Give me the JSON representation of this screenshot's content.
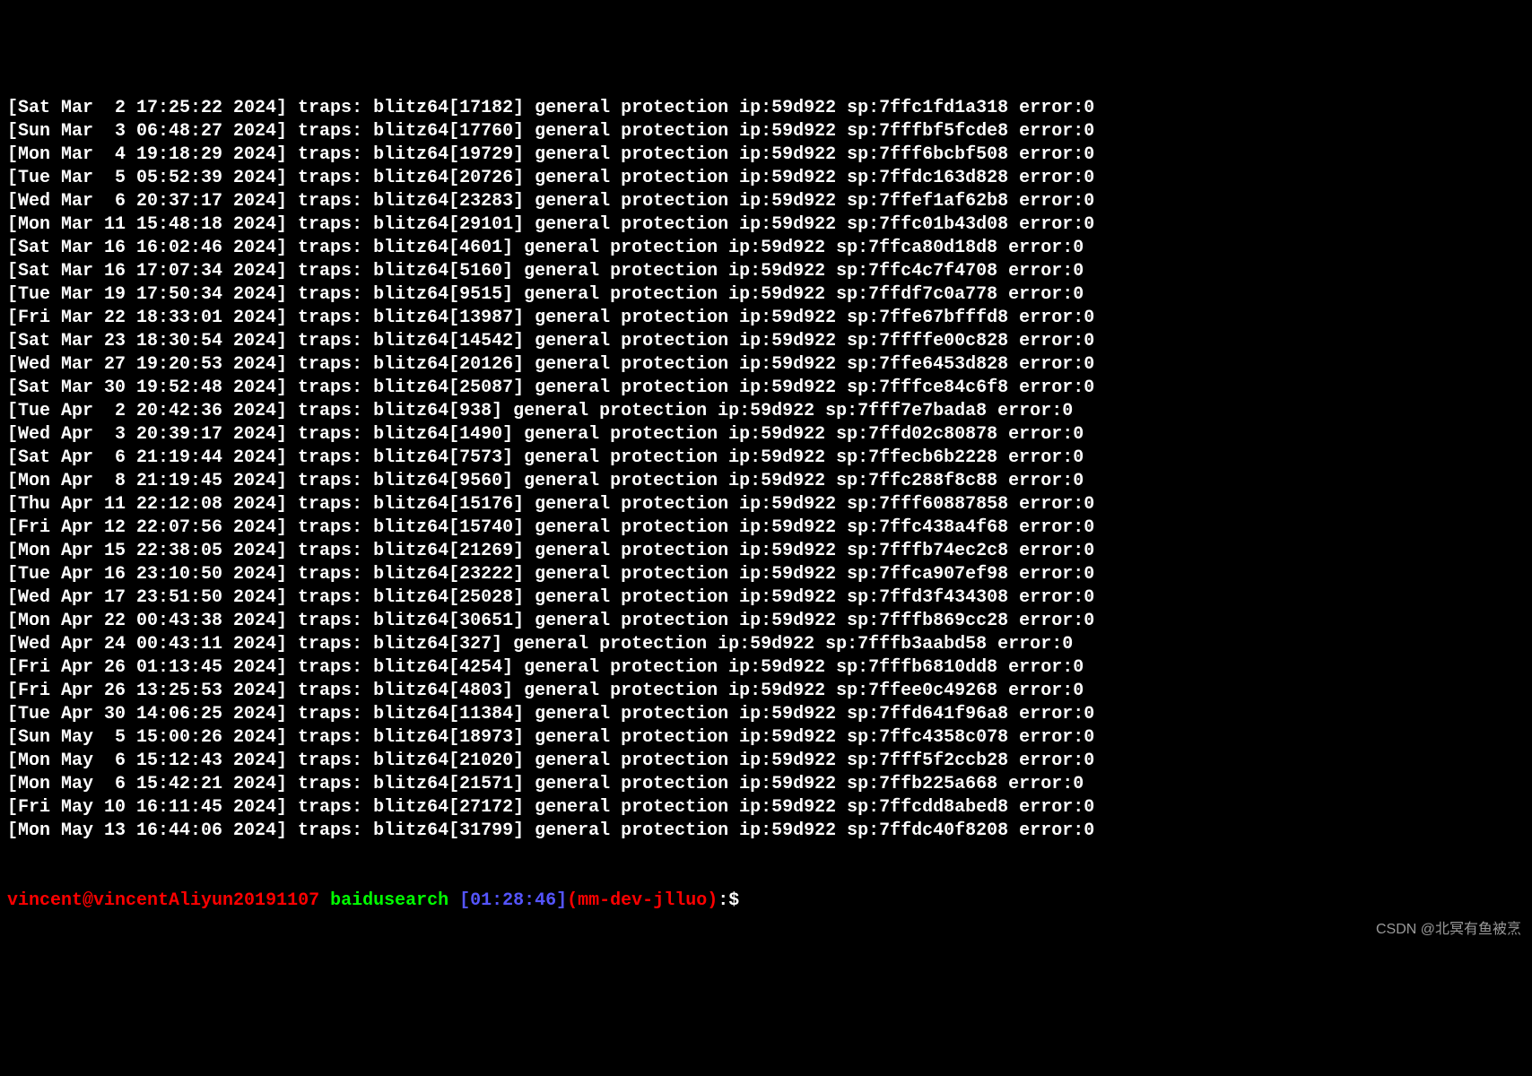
{
  "logs": [
    "[Sat Mar  2 17:25:22 2024] traps: blitz64[17182] general protection ip:59d922 sp:7ffc1fd1a318 error:0",
    "[Sun Mar  3 06:48:27 2024] traps: blitz64[17760] general protection ip:59d922 sp:7fffbf5fcde8 error:0",
    "[Mon Mar  4 19:18:29 2024] traps: blitz64[19729] general protection ip:59d922 sp:7fff6bcbf508 error:0",
    "[Tue Mar  5 05:52:39 2024] traps: blitz64[20726] general protection ip:59d922 sp:7ffdc163d828 error:0",
    "[Wed Mar  6 20:37:17 2024] traps: blitz64[23283] general protection ip:59d922 sp:7ffef1af62b8 error:0",
    "[Mon Mar 11 15:48:18 2024] traps: blitz64[29101] general protection ip:59d922 sp:7ffc01b43d08 error:0",
    "[Sat Mar 16 16:02:46 2024] traps: blitz64[4601] general protection ip:59d922 sp:7ffca80d18d8 error:0",
    "[Sat Mar 16 17:07:34 2024] traps: blitz64[5160] general protection ip:59d922 sp:7ffc4c7f4708 error:0",
    "[Tue Mar 19 17:50:34 2024] traps: blitz64[9515] general protection ip:59d922 sp:7ffdf7c0a778 error:0",
    "[Fri Mar 22 18:33:01 2024] traps: blitz64[13987] general protection ip:59d922 sp:7ffe67bfffd8 error:0",
    "[Sat Mar 23 18:30:54 2024] traps: blitz64[14542] general protection ip:59d922 sp:7ffffe00c828 error:0",
    "[Wed Mar 27 19:20:53 2024] traps: blitz64[20126] general protection ip:59d922 sp:7ffe6453d828 error:0",
    "[Sat Mar 30 19:52:48 2024] traps: blitz64[25087] general protection ip:59d922 sp:7fffce84c6f8 error:0",
    "[Tue Apr  2 20:42:36 2024] traps: blitz64[938] general protection ip:59d922 sp:7fff7e7bada8 error:0",
    "[Wed Apr  3 20:39:17 2024] traps: blitz64[1490] general protection ip:59d922 sp:7ffd02c80878 error:0",
    "[Sat Apr  6 21:19:44 2024] traps: blitz64[7573] general protection ip:59d922 sp:7ffecb6b2228 error:0",
    "[Mon Apr  8 21:19:45 2024] traps: blitz64[9560] general protection ip:59d922 sp:7ffc288f8c88 error:0",
    "[Thu Apr 11 22:12:08 2024] traps: blitz64[15176] general protection ip:59d922 sp:7fff60887858 error:0",
    "[Fri Apr 12 22:07:56 2024] traps: blitz64[15740] general protection ip:59d922 sp:7ffc438a4f68 error:0",
    "[Mon Apr 15 22:38:05 2024] traps: blitz64[21269] general protection ip:59d922 sp:7fffb74ec2c8 error:0",
    "[Tue Apr 16 23:10:50 2024] traps: blitz64[23222] general protection ip:59d922 sp:7ffca907ef98 error:0",
    "[Wed Apr 17 23:51:50 2024] traps: blitz64[25028] general protection ip:59d922 sp:7ffd3f434308 error:0",
    "[Mon Apr 22 00:43:38 2024] traps: blitz64[30651] general protection ip:59d922 sp:7fffb869cc28 error:0",
    "[Wed Apr 24 00:43:11 2024] traps: blitz64[327] general protection ip:59d922 sp:7fffb3aabd58 error:0",
    "[Fri Apr 26 01:13:45 2024] traps: blitz64[4254] general protection ip:59d922 sp:7fffb6810dd8 error:0",
    "[Fri Apr 26 13:25:53 2024] traps: blitz64[4803] general protection ip:59d922 sp:7ffee0c49268 error:0",
    "[Tue Apr 30 14:06:25 2024] traps: blitz64[11384] general protection ip:59d922 sp:7ffd641f96a8 error:0",
    "[Sun May  5 15:00:26 2024] traps: blitz64[18973] general protection ip:59d922 sp:7ffc4358c078 error:0",
    "[Mon May  6 15:12:43 2024] traps: blitz64[21020] general protection ip:59d922 sp:7fff5f2ccb28 error:0",
    "[Mon May  6 15:42:21 2024] traps: blitz64[21571] general protection ip:59d922 sp:7ffb225a668 error:0",
    "[Fri May 10 16:11:45 2024] traps: blitz64[27172] general protection ip:59d922 sp:7ffcdd8abed8 error:0",
    "[Mon May 13 16:44:06 2024] traps: blitz64[31799] general protection ip:59d922 sp:7ffdc40f8208 error:0"
  ],
  "prompt": {
    "user": "vincent",
    "at": "@",
    "host": "vincentAliyun20191107",
    "space": " ",
    "dir": "baidusearch",
    "time_open": " [",
    "time": "01:28:46",
    "time_close": "]",
    "context": "(mm-dev-jlluo)",
    "symbol": ":$ "
  },
  "watermark": "CSDN @北冥有鱼被烹"
}
